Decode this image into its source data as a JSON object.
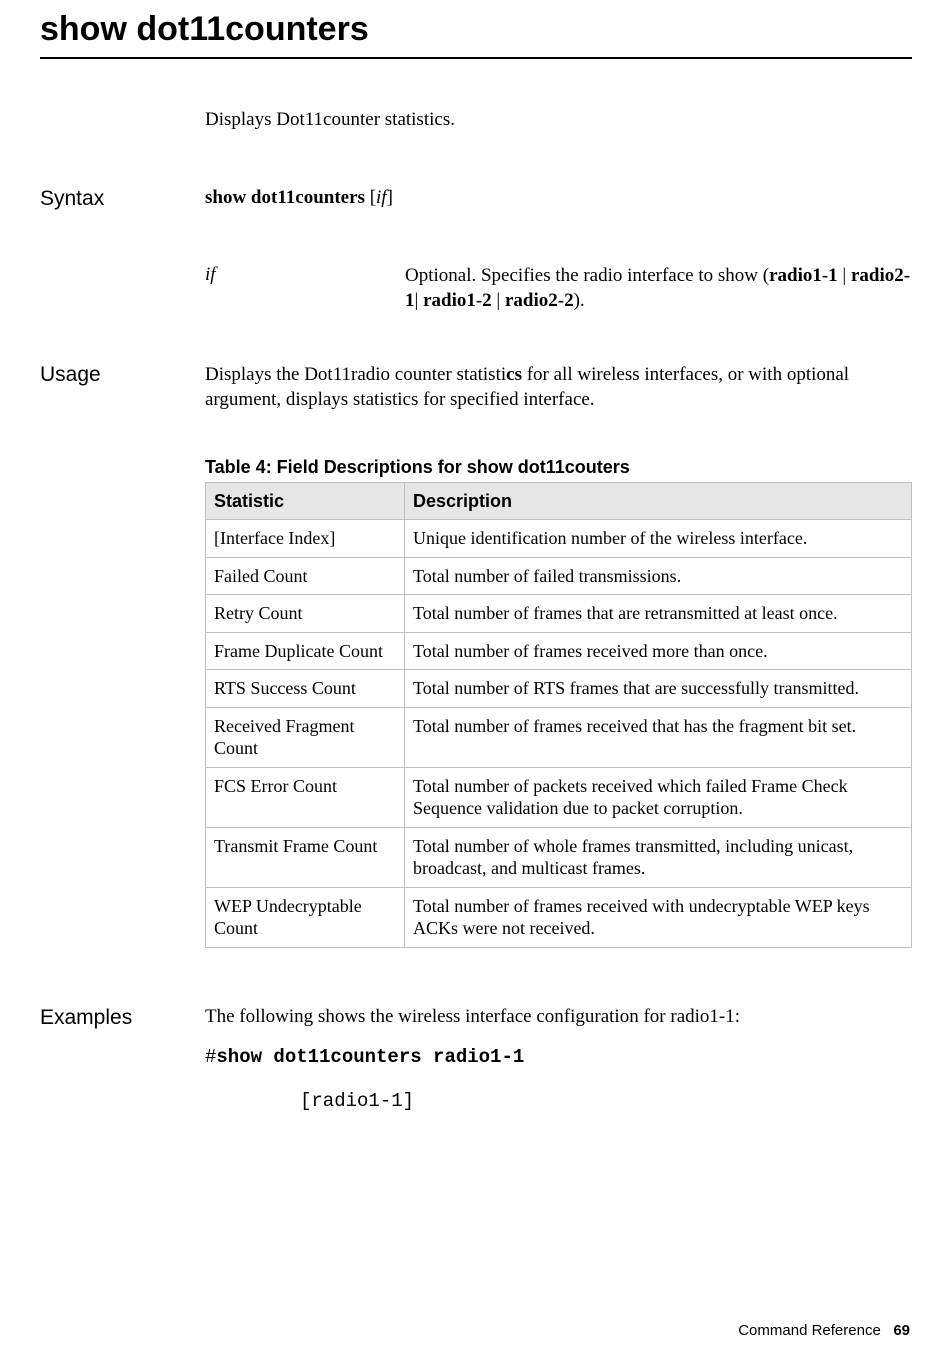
{
  "title": "show dot11counters",
  "intro": "Displays Dot11counter statistics.",
  "syntax": {
    "label": "Syntax",
    "command_bold": "show dot11counters",
    "command_rest_open": " [",
    "command_italic": "if",
    "command_rest_close": "]",
    "params": [
      {
        "name": "if",
        "desc_prefix": "Optional. Specifies the radio interface to show (",
        "opt1": "radio1-1",
        "sep1": " | ",
        "opt2": "radio2-1",
        "sep2": "| ",
        "opt3": "radio1-2",
        "sep3": " | ",
        "opt4": "radio2-2",
        "desc_suffix": ")."
      }
    ]
  },
  "usage": {
    "label": "Usage",
    "text_before": "Displays the Dot11radio counter statisti",
    "text_bold": "cs",
    "text_after": " for all wireless interfaces, or with optional argument, displays statistics for specified interface."
  },
  "table": {
    "caption": "Table 4: Field Descriptions for show dot11couters",
    "headers": {
      "col1": "Statistic",
      "col2": "Description"
    },
    "rows": [
      {
        "stat": "[Interface Index]",
        "desc": "Unique identification number of the wireless  interface."
      },
      {
        "stat": "Failed Count",
        "desc": "Total number of failed transmissions."
      },
      {
        "stat": "Retry Count",
        "desc": "Total number of frames that are retransmitted at least once."
      },
      {
        "stat": "Frame Duplicate Count",
        "desc": "Total number of frames received more than once."
      },
      {
        "stat": "RTS Success Count",
        "desc": "Total number of RTS frames that are successfully transmitted."
      },
      {
        "stat": "Received Fragment Count",
        "desc": "Total number of frames received that has the fragment bit set."
      },
      {
        "stat": "FCS Error Count",
        "desc": "Total number of packets received which failed Frame Check Sequence validation due to packet corruption."
      },
      {
        "stat": "Transmit Frame Count",
        "desc": "Total number of whole frames transmitted, including unicast, broadcast, and multicast frames."
      },
      {
        "stat": "WEP Undecryptable Count",
        "desc": "Total number of frames received with undecryptable WEP keys ACKs were not received."
      }
    ]
  },
  "examples": {
    "label": "Examples",
    "intro": "The following shows the wireless interface configuration for radio1-1:",
    "hash": "#",
    "command": "show dot11counters radio1-1",
    "output1": "[radio1-1]"
  },
  "footer": {
    "text": "Command Reference",
    "page": "69"
  }
}
